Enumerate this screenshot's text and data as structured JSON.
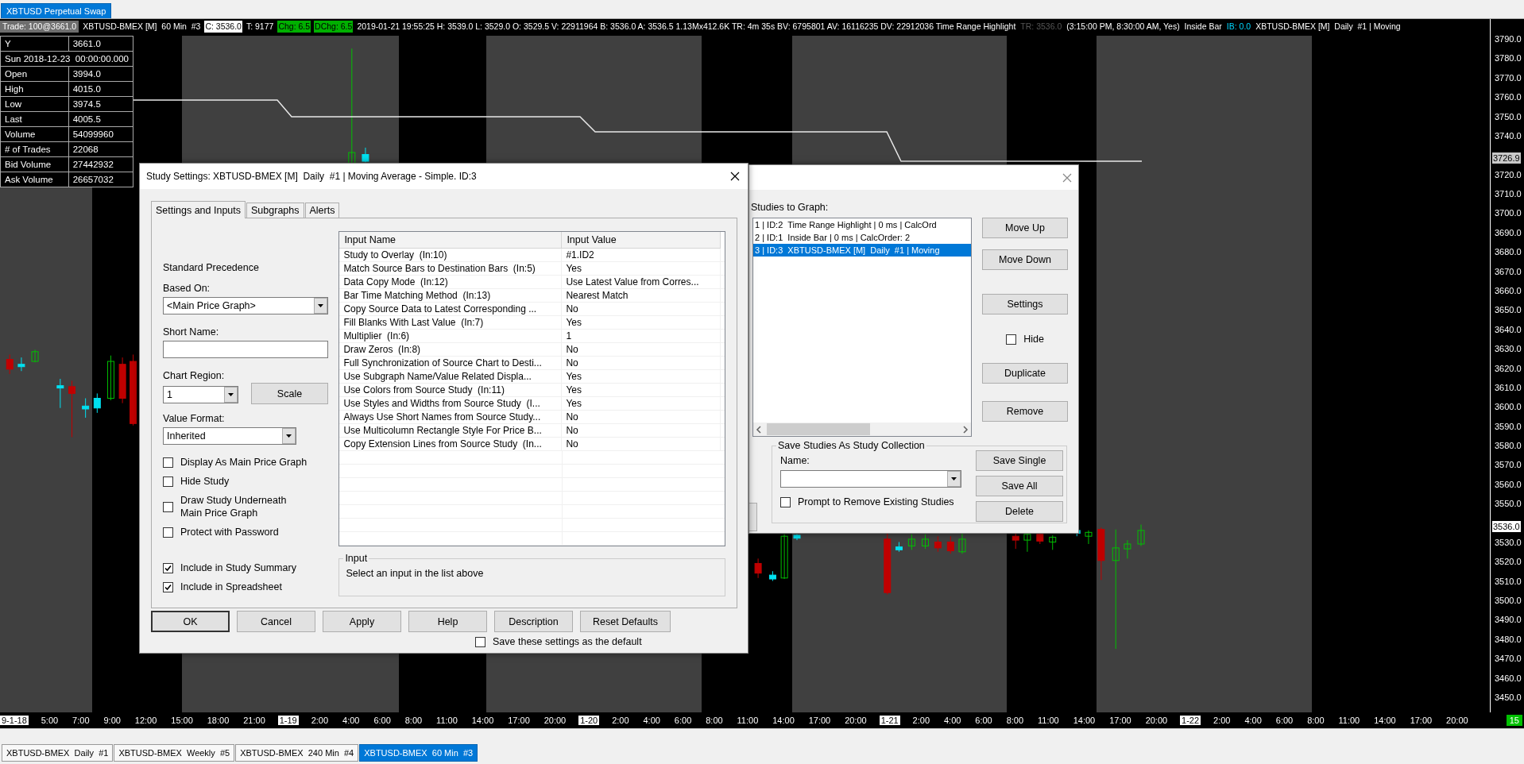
{
  "top_tabs": [
    {
      "label": "XBTUSD Perpetual Swap",
      "selected": true
    }
  ],
  "chart": {
    "header": [
      {
        "text": "Trade: 100@3661.0",
        "kind": "boxed"
      },
      {
        "text": "XBTUSD-BMEX [M]  60 Min  #3",
        "kind": "plain"
      },
      {
        "text": "C: 3536.0",
        "kind": "white"
      },
      {
        "text": "T: 9177",
        "kind": "plain"
      },
      {
        "text": "Chg: 6.5",
        "kind": "green"
      },
      {
        "text": "DChg: 6.5",
        "kind": "green"
      },
      {
        "text": "2019-01-21 19:55:25 H: 3539.0 L: 3529.0 O: 3529.5 V: 22911964 B: 3536.0 A: 3536.5 1.13Mx412.6K TR: 4m 35s BV: 6795801 AV: 16116235 DV: 22912036 Time Range Highlight",
        "kind": "plain"
      },
      {
        "text": "TR: 3536.0",
        "kind": "dim"
      },
      {
        "text": "(3:15:00 PM, 8:30:00 AM, Yes)  Inside Bar",
        "kind": "plain"
      },
      {
        "text": "IB: 0.0",
        "kind": "cyan"
      },
      {
        "text": "XBTUSD-BMEX [M]  Daily  #1 | Moving",
        "kind": "plain"
      }
    ],
    "data_panel": [
      {
        "label": "Y",
        "value": "3661.0"
      },
      {
        "label": "Sun 2018-12-23  00:00:00.000"
      },
      {
        "label": "Open",
        "value": "3994.0"
      },
      {
        "label": "High",
        "value": "4015.0"
      },
      {
        "label": "Low",
        "value": "3974.5"
      },
      {
        "label": "Last",
        "value": "4005.5"
      },
      {
        "label": "Volume",
        "value": "54099960"
      },
      {
        "label": "# of Trades",
        "value": "22068"
      },
      {
        "label": "Bid Volume",
        "value": "27442932"
      },
      {
        "label": "Ask Volume",
        "value": "26657032"
      }
    ],
    "price_axis": [
      {
        "text": "3790.0",
        "kind": "tick"
      },
      {
        "text": "3780.0",
        "kind": "tick"
      },
      {
        "text": "3770.0",
        "kind": "tick"
      },
      {
        "text": "3760.0",
        "kind": "tick"
      },
      {
        "text": "3750.0",
        "kind": "tick"
      },
      {
        "text": "3740.0",
        "kind": "tick"
      },
      {
        "text": "3726.9",
        "kind": "marker-gray"
      },
      {
        "text": "3720.0",
        "kind": "tick"
      },
      {
        "text": "3710.0",
        "kind": "tick"
      },
      {
        "text": "3700.0",
        "kind": "tick"
      },
      {
        "text": "3690.0",
        "kind": "tick"
      },
      {
        "text": "3680.0",
        "kind": "tick"
      },
      {
        "text": "3670.0",
        "kind": "tick"
      },
      {
        "text": "3660.0",
        "kind": "tick"
      },
      {
        "text": "3650.0",
        "kind": "tick"
      },
      {
        "text": "3640.0",
        "kind": "tick"
      },
      {
        "text": "3630.0",
        "kind": "tick"
      },
      {
        "text": "3620.0",
        "kind": "tick"
      },
      {
        "text": "3610.0",
        "kind": "tick"
      },
      {
        "text": "3600.0",
        "kind": "tick"
      },
      {
        "text": "3590.0",
        "kind": "tick"
      },
      {
        "text": "3580.0",
        "kind": "tick"
      },
      {
        "text": "3570.0",
        "kind": "tick"
      },
      {
        "text": "3560.0",
        "kind": "tick"
      },
      {
        "text": "3550.0",
        "kind": "tick"
      },
      {
        "text": "3536.0",
        "kind": "marker-white"
      },
      {
        "text": "3530.0",
        "kind": "tick"
      },
      {
        "text": "3520.0",
        "kind": "tick"
      },
      {
        "text": "3510.0",
        "kind": "tick"
      },
      {
        "text": "3500.0",
        "kind": "tick"
      },
      {
        "text": "3490.0",
        "kind": "tick"
      },
      {
        "text": "3480.0",
        "kind": "tick"
      },
      {
        "text": "3470.0",
        "kind": "tick"
      },
      {
        "text": "3460.0",
        "kind": "tick"
      },
      {
        "text": "3450.0",
        "kind": "tick"
      }
    ],
    "time_axis": [
      {
        "text": "9-1-18",
        "kind": "date"
      },
      {
        "text": "5:00",
        "kind": "time"
      },
      {
        "text": "7:00",
        "kind": "time"
      },
      {
        "text": "9:00",
        "kind": "time"
      },
      {
        "text": "12:00",
        "kind": "time"
      },
      {
        "text": "15:00",
        "kind": "time"
      },
      {
        "text": "18:00",
        "kind": "time"
      },
      {
        "text": "21:00",
        "kind": "time"
      },
      {
        "text": "1-19",
        "kind": "date"
      },
      {
        "text": "2:00",
        "kind": "time"
      },
      {
        "text": "4:00",
        "kind": "time"
      },
      {
        "text": "6:00",
        "kind": "time"
      },
      {
        "text": "8:00",
        "kind": "time"
      },
      {
        "text": "11:00",
        "kind": "time"
      },
      {
        "text": "14:00",
        "kind": "time"
      },
      {
        "text": "17:00",
        "kind": "time"
      },
      {
        "text": "20:00",
        "kind": "time"
      },
      {
        "text": "1-20",
        "kind": "date"
      },
      {
        "text": "2:00",
        "kind": "time"
      },
      {
        "text": "4:00",
        "kind": "time"
      },
      {
        "text": "6:00",
        "kind": "time"
      },
      {
        "text": "8:00",
        "kind": "time"
      },
      {
        "text": "11:00",
        "kind": "time"
      },
      {
        "text": "14:00",
        "kind": "time"
      },
      {
        "text": "17:00",
        "kind": "time"
      },
      {
        "text": "20:00",
        "kind": "time"
      },
      {
        "text": "1-21",
        "kind": "date"
      },
      {
        "text": "2:00",
        "kind": "time"
      },
      {
        "text": "4:00",
        "kind": "time"
      },
      {
        "text": "6:00",
        "kind": "time"
      },
      {
        "text": "8:00",
        "kind": "time"
      },
      {
        "text": "11:00",
        "kind": "time"
      },
      {
        "text": "14:00",
        "kind": "time"
      },
      {
        "text": "17:00",
        "kind": "time"
      },
      {
        "text": "20:00",
        "kind": "time"
      },
      {
        "text": "1-22",
        "kind": "date"
      },
      {
        "text": "2:00",
        "kind": "time"
      },
      {
        "text": "4:00",
        "kind": "time"
      },
      {
        "text": "6:00",
        "kind": "time"
      },
      {
        "text": "8:00",
        "kind": "time"
      },
      {
        "text": "11:00",
        "kind": "time"
      },
      {
        "text": "14:00",
        "kind": "time"
      },
      {
        "text": "17:00",
        "kind": "time"
      },
      {
        "text": "20:00",
        "kind": "time"
      }
    ],
    "bar_count": "15"
  },
  "study_settings": {
    "title": "Study Settings: XBTUSD-BMEX [M]  Daily  #1 | Moving Average - Simple. ID:3",
    "tabs": [
      {
        "label": "Settings and Inputs",
        "selected": true
      },
      {
        "label": "Subgraphs",
        "selected": false
      },
      {
        "label": "Alerts",
        "selected": false
      }
    ],
    "precedence": "Standard Precedence",
    "based_on": {
      "label": "Based On:",
      "value": "<Main Price Graph>"
    },
    "short_name": {
      "label": "Short Name:"
    },
    "chart_region": {
      "label": "Chart Region:",
      "value": "1"
    },
    "scale_button": "Scale",
    "value_format": {
      "label": "Value Format:",
      "value": "Inherited"
    },
    "options": [
      {
        "label": "Display As Main Price Graph",
        "checked": false
      },
      {
        "label": "Hide Study",
        "checked": false
      },
      {
        "label": "Draw Study Underneath Main Price Graph",
        "checked": false
      },
      {
        "label": "Protect with Password",
        "checked": false
      }
    ],
    "include_options": [
      {
        "label": "Include in Study Summary",
        "checked": true
      },
      {
        "label": "Include in Spreadsheet",
        "checked": true
      }
    ],
    "inputs": {
      "columns": [
        "Input Name",
        "Input Value"
      ],
      "rows": [
        {
          "name": "Study to Overlay  (In:10)",
          "value": "#1.ID2"
        },
        {
          "name": "Match Source Bars to Destination Bars  (In:5)",
          "value": "Yes"
        },
        {
          "name": "Data Copy Mode  (In:12)",
          "value": "Use Latest Value from Corres..."
        },
        {
          "name": "Bar Time Matching Method  (In:13)",
          "value": "Nearest Match"
        },
        {
          "name": "Copy Source Data to Latest Corresponding ...",
          "value": "No"
        },
        {
          "name": "Fill Blanks With Last Value  (In:7)",
          "value": "Yes"
        },
        {
          "name": "Multiplier  (In:6)",
          "value": "1"
        },
        {
          "name": "Draw Zeros  (In:8)",
          "value": "No"
        },
        {
          "name": "Full Synchronization of Source Chart to Desti...",
          "value": "No"
        },
        {
          "name": "Use Subgraph Name/Value Related Displa...",
          "value": "Yes"
        },
        {
          "name": "Use Colors from Source Study  (In:11)",
          "value": "Yes"
        },
        {
          "name": "Use Styles and Widths from Source Study  (I...",
          "value": "Yes"
        },
        {
          "name": "Always Use Short Names from Source Study...",
          "value": "No"
        },
        {
          "name": "Use Multicolumn Rectangle Style For Price B...",
          "value": "No"
        },
        {
          "name": "Copy Extension Lines from Source Study  (In...",
          "value": "No"
        }
      ]
    },
    "input_help": {
      "title": "Input",
      "text": "Select an input in the list above"
    },
    "buttons": [
      {
        "label": "OK",
        "default": true
      },
      {
        "label": "Cancel",
        "default": false
      },
      {
        "label": "Apply",
        "default": false
      },
      {
        "label": "Help",
        "default": false
      },
      {
        "label": "Description",
        "default": false
      },
      {
        "label": "Reset Defaults",
        "default": false
      }
    ],
    "save_default": {
      "label": "Save these settings as the default",
      "checked": false
    }
  },
  "studies_dialog": {
    "list_label": "Studies to Graph:",
    "studies": [
      {
        "text": "1 | ID:2  Time Range Highlight | 0 ms | CalcOrd",
        "selected": false
      },
      {
        "text": "2 | ID:1  Inside Bar | 0 ms | CalcOrder: 2",
        "selected": false
      },
      {
        "text": "3 | ID:3  XBTUSD-BMEX [M]  Daily  #1 | Moving",
        "selected": true
      }
    ],
    "side_controls": [
      {
        "kind": "button",
        "label": "Move Up"
      },
      {
        "kind": "button",
        "label": "Move Down"
      },
      {
        "kind": "button",
        "label": "Settings"
      },
      {
        "kind": "checkbox",
        "label": "Hide",
        "checked": false
      },
      {
        "kind": "button",
        "label": "Duplicate"
      },
      {
        "kind": "button",
        "label": "Remove"
      }
    ],
    "collection": {
      "title": "Save Studies As Study Collection",
      "name_label": "Name:",
      "prompt": {
        "label": "Prompt to Remove Existing Studies",
        "checked": false
      },
      "buttons": [
        "Save Single",
        "Save All",
        "Delete"
      ]
    }
  },
  "bottom_tabs": [
    {
      "label": "XBTUSD-BMEX  Daily  #1",
      "selected": false
    },
    {
      "label": "XBTUSD-BMEX  Weekly  #5",
      "selected": false
    },
    {
      "label": "XBTUSD-BMEX  240 Min  #4",
      "selected": false
    },
    {
      "label": "XBTUSD-BMEX  60 Min  #3",
      "selected": true
    }
  ]
}
